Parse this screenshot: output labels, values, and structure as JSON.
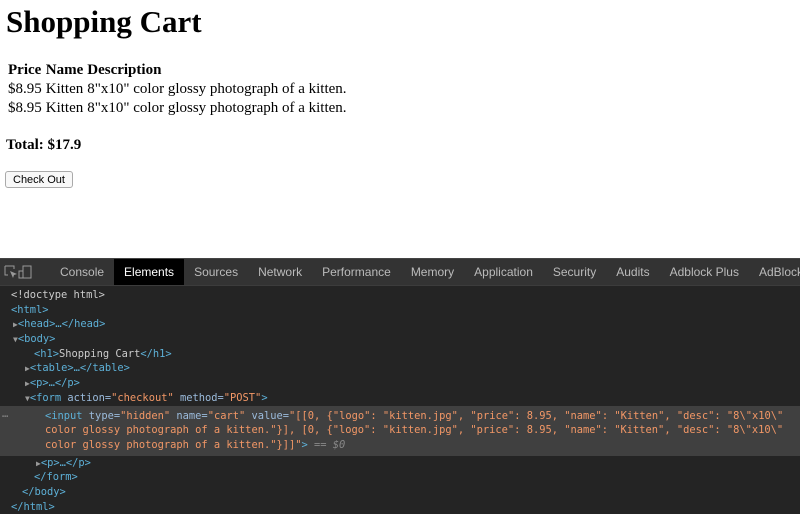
{
  "page": {
    "title": "Shopping Cart",
    "table": {
      "headers": [
        "Price",
        "Name",
        "Description"
      ],
      "rows": [
        [
          "$8.95",
          "Kitten",
          "8\"x10\" color glossy photograph of a kitten."
        ],
        [
          "$8.95",
          "Kitten",
          "8\"x10\" color glossy photograph of a kitten."
        ]
      ]
    },
    "total": "Total: $17.9",
    "checkout_label": "Check Out"
  },
  "devtools": {
    "tabs": [
      "Console",
      "Elements",
      "Sources",
      "Network",
      "Performance",
      "Memory",
      "Application",
      "Security",
      "Audits",
      "Adblock Plus",
      "AdBlock"
    ],
    "active_tab": "Elements",
    "lines": {
      "doctype": "<!doctype html>",
      "html_open": "<html>",
      "head": "<head>…</head>",
      "body_open": "<body>",
      "h1_open": "<h1>",
      "h1_text": "Shopping Cart",
      "h1_close": "</h1>",
      "table": "<table>…</table>",
      "p1": "<p>…</p>",
      "form_tag": "<form",
      "form_action_attr": " action=",
      "form_action_val": "\"checkout\"",
      "form_method_attr": " method=",
      "form_method_val": "\"POST\"",
      "form_end": ">",
      "input_tag": "<input",
      "input_type_attr": " type=",
      "input_type_val": "\"hidden\"",
      "input_name_attr": " name=",
      "input_name_val": "\"cart\"",
      "input_value_attr": " value=",
      "input_value_1": "\"[[0, {\"logo\": \"kitten.jpg\", \"price\": 8.95, \"name\": \"Kitten\", \"desc\": \"8\\\"x10\\\"",
      "input_value_2": "color glossy photograph of a kitten.\"}], [0, {\"logo\": \"kitten.jpg\", \"price\": 8.95, \"name\": \"Kitten\", \"desc\": \"8\\\"x10\\\"",
      "input_value_3": "color glossy photograph of a kitten.\"}]]\"",
      "input_end": ">",
      "selected_marker": " == $0",
      "p2": "<p>…</p>",
      "form_close": "</form>",
      "body_close": "</body>",
      "html_close": "</html>",
      "dots": "…"
    }
  },
  "colors": {
    "tag": "#5db0d7",
    "attr": "#9bbbdc",
    "value": "#f29766",
    "background": "#242424"
  }
}
